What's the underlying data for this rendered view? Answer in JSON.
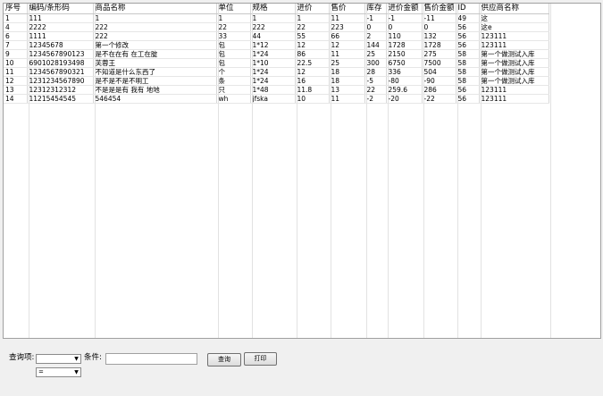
{
  "grid": {
    "columns": [
      "序号",
      "编码/条形码",
      "商品名称",
      "单位",
      "规格",
      "进价",
      "售价",
      "库存",
      "进价金额",
      "售价金额",
      "ID",
      "供应商名称"
    ],
    "rows": [
      [
        "1",
        "111",
        "1",
        "1",
        "1",
        "1",
        "11",
        "-1",
        "-1",
        "-11",
        "49",
        "这"
      ],
      [
        "4",
        "2222",
        "222",
        "22",
        "222",
        "22",
        "223",
        "0",
        "0",
        "0",
        "56",
        "这e"
      ],
      [
        "6",
        "1111",
        "222",
        "33",
        "44",
        "55",
        "66",
        "2",
        "110",
        "132",
        "56",
        "123111"
      ],
      [
        "7",
        "12345678",
        "第一个修改",
        "包",
        "1*12",
        "12",
        "12",
        "144",
        "1728",
        "1728",
        "56",
        "123111"
      ],
      [
        "9",
        "1234567890123",
        "是不在在有 在工在腚",
        "包",
        "1*24",
        "86",
        "11",
        "25",
        "2150",
        "275",
        "58",
        "第一个做测试入库"
      ],
      [
        "10",
        "6901028193498",
        "芙蓉王",
        "包",
        "1*10",
        "22.5",
        "25",
        "300",
        "6750",
        "7500",
        "58",
        "第一个做测试入库"
      ],
      [
        "11",
        "1234567890321",
        "不知道是什么东西了",
        "个",
        "1*24",
        "12",
        "18",
        "28",
        "336",
        "504",
        "58",
        "第一个做测试入库"
      ],
      [
        "12",
        "1231234567890",
        "是不是不是不明工",
        "条",
        "1*24",
        "16",
        "18",
        "-5",
        "-80",
        "-90",
        "58",
        "第一个做测试入库"
      ],
      [
        "13",
        "12312312312",
        "不是是是有 我有 地地",
        "只",
        "1*48",
        "11.8",
        "13",
        "22",
        "259.6",
        "286",
        "56",
        "123111"
      ],
      [
        "14",
        "11215454545",
        "546454",
        "wh",
        "jfska",
        "10",
        "11",
        "-2",
        "-20",
        "-22",
        "56",
        "123111"
      ]
    ]
  },
  "query": {
    "field_label": "查询项:",
    "field_value": "",
    "condition_label": "条件:",
    "condition_value": "",
    "operator_value": "=",
    "query_button": "查询",
    "print_button": "打印"
  }
}
